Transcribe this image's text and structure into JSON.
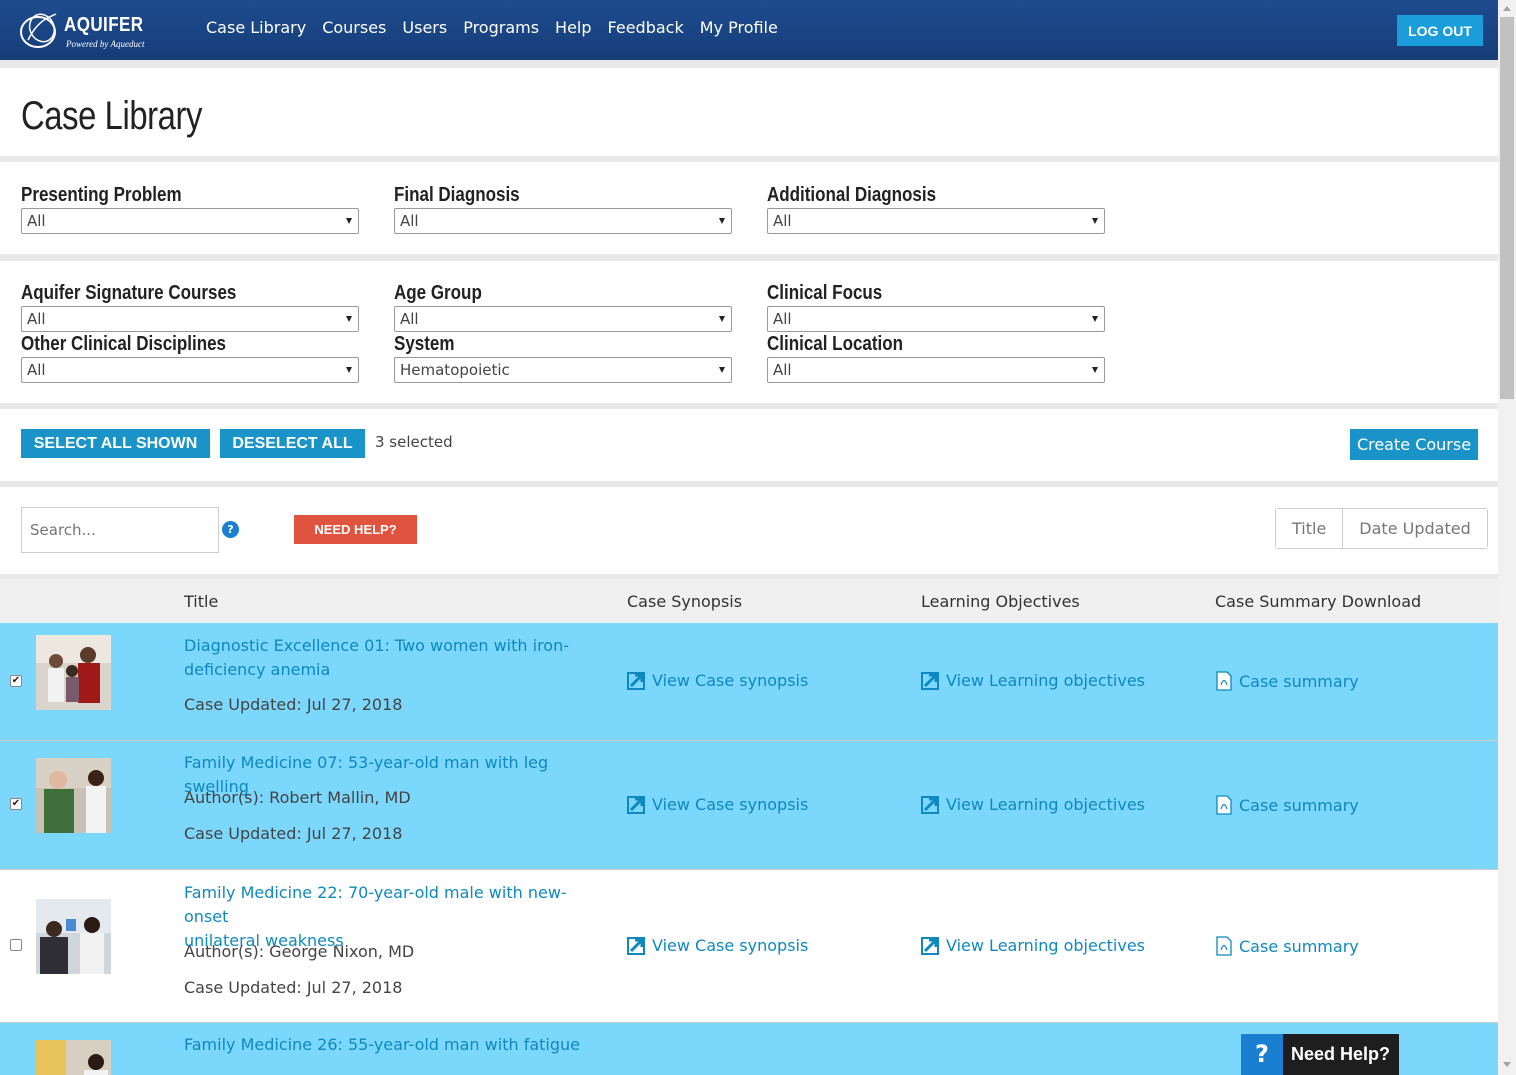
{
  "brand": {
    "name": "AQUIFER",
    "tagline": "Powered by Aqueduct"
  },
  "nav": {
    "items": [
      {
        "label": "Case Library"
      },
      {
        "label": "Courses"
      },
      {
        "label": "Users"
      },
      {
        "label": "Programs"
      },
      {
        "label": "Help"
      },
      {
        "label": "Feedback"
      },
      {
        "label": "My Profile"
      }
    ],
    "logout_label": "LOG OUT"
  },
  "page": {
    "title": "Case Library"
  },
  "filters": {
    "row1": [
      {
        "label": "Presenting Problem",
        "value": "All"
      },
      {
        "label": "Final Diagnosis",
        "value": "All"
      },
      {
        "label": "Additional Diagnosis",
        "value": "All"
      }
    ],
    "row2": [
      {
        "label": "Aquifer Signature Courses",
        "value": "All"
      },
      {
        "label": "Age Group",
        "value": "All"
      },
      {
        "label": "Clinical Focus",
        "value": "All"
      },
      {
        "label": "Other Clinical Disciplines",
        "value": "All"
      },
      {
        "label": "System",
        "value": "Hematopoietic"
      },
      {
        "label": "Clinical Location",
        "value": "All"
      }
    ]
  },
  "selection": {
    "select_all_label": "SELECT ALL SHOWN",
    "deselect_all_label": "DESELECT ALL",
    "count_text": "3 selected",
    "create_course_label": "Create Course"
  },
  "search": {
    "placeholder": "Search...",
    "help_icon": "?",
    "need_help_label": "NEED HELP?",
    "sort_options": [
      "Title",
      "Date Updated"
    ]
  },
  "table": {
    "headers": [
      "Title",
      "Case Synopsis",
      "Learning Objectives",
      "Case Summary Download"
    ],
    "rows": [
      {
        "selected": true,
        "title_line1": "Diagnostic Excellence 01: Two women with iron-",
        "title_line2": "deficiency anemia",
        "author": "",
        "updated": "Case Updated: Jul 27, 2018",
        "synopsis": "View Case synopsis",
        "objectives": "View Learning objectives",
        "summary": "Case summary"
      },
      {
        "selected": true,
        "title_line1": "Family Medicine 07: 53-year-old man with leg swelling",
        "title_line2": "",
        "author": "Author(s): Robert Mallin, MD",
        "updated": "Case Updated: Jul 27, 2018",
        "synopsis": "View Case synopsis",
        "objectives": "View Learning objectives",
        "summary": "Case summary"
      },
      {
        "selected": false,
        "title_line1": "Family Medicine 22: 70-year-old male with new-onset",
        "title_line2": "unilateral weakness",
        "author": "Author(s): George Nixon, MD",
        "updated": "Case Updated: Jul 27, 2018",
        "synopsis": "View Case synopsis",
        "objectives": "View Learning objectives",
        "summary": "Case summary"
      },
      {
        "selected": true,
        "title_line1": "Family Medicine 26: 55-year-old man with fatigue",
        "title_line2": "",
        "author": "",
        "updated": "",
        "synopsis": "",
        "objectives": "",
        "summary": ""
      }
    ]
  },
  "help_widget": {
    "icon": "?",
    "label": "Need Help?"
  },
  "colors": {
    "nav_bg": "#1e4c90",
    "accent": "#1a93c8",
    "selected_row": "#7bd7fb",
    "link": "#0f88bf",
    "help_red": "#e0533f"
  }
}
